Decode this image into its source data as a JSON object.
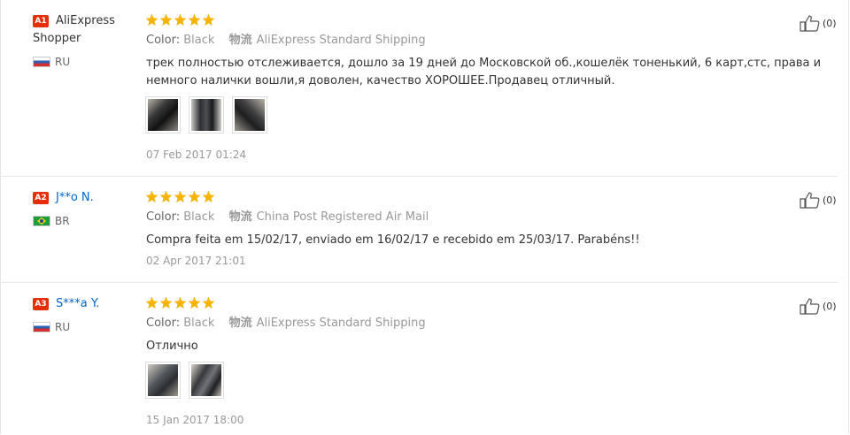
{
  "reviews": [
    {
      "badge": "A1",
      "name": "AliExpress Shopper",
      "country": "RU",
      "color_label": "Color:",
      "color_value": "Black",
      "shipping_icon": "物流",
      "shipping": "AliExpress Standard Shipping",
      "text": "трек полностью отслеживается, дошло за 19 дней до Московской об.,кошелёк тоненький, 6 карт,стс, права и немного налички вошли,я доволен, качество ХОРОШЕЕ.Продавец отличный.",
      "photo_count": 3,
      "date": "07 Feb 2017 01:24",
      "likes": "(0)",
      "rating": 5
    },
    {
      "badge": "A2",
      "name": "J**o N.",
      "country": "BR",
      "color_label": "Color:",
      "color_value": "Black",
      "shipping_icon": "物流",
      "shipping": "China Post Registered Air Mail",
      "text": "Compra feita em 15/02/17, enviado em 16/02/17 e recebido em 25/03/17. Parabéns!!",
      "photo_count": 0,
      "date": "02 Apr 2017 21:01",
      "likes": "(0)",
      "rating": 5
    },
    {
      "badge": "A3",
      "name": "S***a Y.",
      "country": "RU",
      "color_label": "Color:",
      "color_value": "Black",
      "shipping_icon": "物流",
      "shipping": "AliExpress Standard Shipping",
      "text": "Отлично",
      "photo_count": 2,
      "date": "15 Jan 2017 18:00",
      "likes": "(0)",
      "rating": 5
    }
  ],
  "colors": {
    "star": "#f7b400",
    "badge": "#e62e04",
    "link": "#0066cc"
  },
  "icons": {
    "rating": "star-icon",
    "like": "thumbs-up-icon",
    "flag_ru": "russia-flag-icon",
    "flag_br": "brazil-flag-icon",
    "shipping": "shipping-icon"
  }
}
